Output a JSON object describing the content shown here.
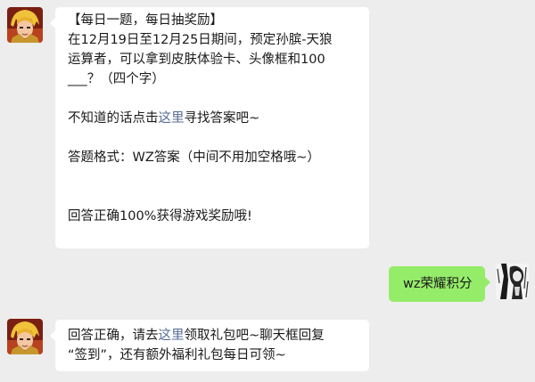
{
  "messages": [
    {
      "sender": "game",
      "lines": [
        "【每日一题，每日抽奖励】",
        "在12月19日至12月25日期间，预定孙膑-天狼",
        "运算者，可以拿到皮肤体验卡、头像框和100",
        "___？（四个字）"
      ],
      "hint": {
        "prefix": "不知道的话点击",
        "link": "这里",
        "suffix": "寻找答案吧~"
      },
      "format_line": "答题格式：WZ答案（中间不用加空格哦~）",
      "reward_line": "回答正确100%获得游戏奖励哦!"
    },
    {
      "sender": "user",
      "text": "wz荣耀积分"
    },
    {
      "sender": "game",
      "reply": {
        "prefix": "回答正确，请去",
        "link": "这里",
        "suffix": "领取礼包吧~聊天框回复",
        "line2": "“签到”，还有额外福利礼包每日可领~"
      }
    }
  ],
  "colors": {
    "background": "#ededed",
    "bubble_left": "#ffffff",
    "bubble_right": "#95ec69",
    "link": "#576b95"
  },
  "icons": {
    "game_avatar": "hero-avatar-icon",
    "user_avatar": "user-avatar-icon"
  }
}
